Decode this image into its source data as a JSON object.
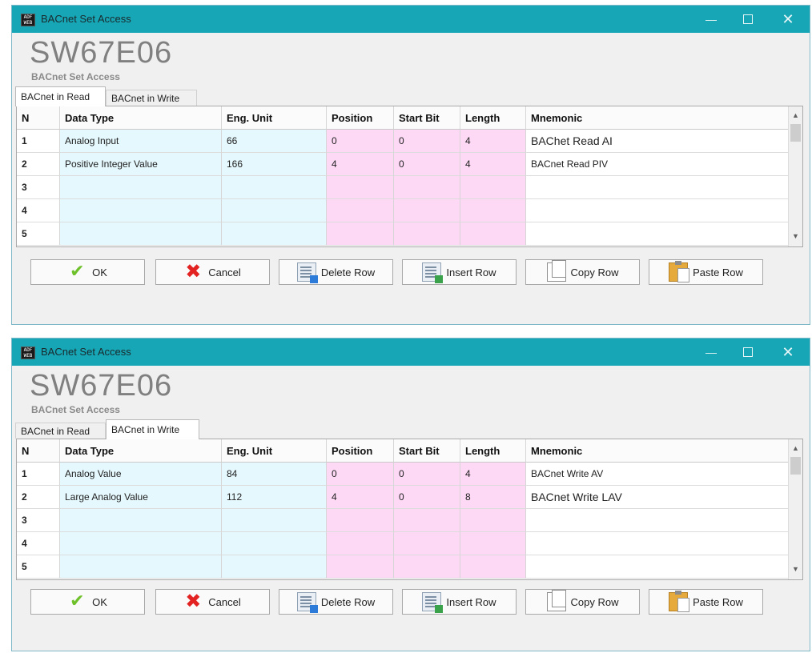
{
  "windows": [
    {
      "title": "BACnet Set Access",
      "app_icon_text": "ADF WEB",
      "product_code": "SW67E06",
      "subtitle": "BACnet Set Access",
      "active_tab": 0,
      "tabs": [
        "BACnet in Read",
        "BACnet in Write"
      ],
      "columns": [
        "N",
        "Data Type",
        "Eng. Unit",
        "Position",
        "Start Bit",
        "Length",
        "Mnemonic"
      ],
      "rows": [
        [
          "1",
          "Analog Input",
          "66",
          "0",
          "0",
          "4",
          "BAChet Read AI"
        ],
        [
          "2",
          "Positive Integer Value",
          "166",
          "4",
          "0",
          "4",
          "BACnet Read PIV"
        ],
        [
          "3",
          "",
          "",
          "",
          "",
          "",
          ""
        ],
        [
          "4",
          "",
          "",
          "",
          "",
          "",
          ""
        ],
        [
          "5",
          "",
          "",
          "",
          "",
          "",
          ""
        ]
      ],
      "buttons": {
        "ok": "OK",
        "cancel": "Cancel",
        "delete_row": "Delete Row",
        "insert_row": "Insert Row",
        "copy_row": "Copy Row",
        "paste_row": "Paste Row"
      }
    },
    {
      "title": "BACnet Set Access",
      "app_icon_text": "ADF WEB",
      "product_code": "SW67E06",
      "subtitle": "BACnet Set Access",
      "active_tab": 1,
      "tabs": [
        "BACnet in Read",
        "BACnet in Write"
      ],
      "columns": [
        "N",
        "Data Type",
        "Eng. Unit",
        "Position",
        "Start Bit",
        "Length",
        "Mnemonic"
      ],
      "rows": [
        [
          "1",
          "Analog Value",
          "84",
          "0",
          "0",
          "4",
          "BACnet Write AV"
        ],
        [
          "2",
          "Large Analog Value",
          "112",
          "4",
          "0",
          "8",
          "BACnet Write LAV"
        ],
        [
          "3",
          "",
          "",
          "",
          "",
          "",
          ""
        ],
        [
          "4",
          "",
          "",
          "",
          "",
          "",
          ""
        ],
        [
          "5",
          "",
          "",
          "",
          "",
          "",
          ""
        ]
      ],
      "buttons": {
        "ok": "OK",
        "cancel": "Cancel",
        "delete_row": "Delete Row",
        "insert_row": "Insert Row",
        "copy_row": "Copy Row",
        "paste_row": "Paste Row"
      }
    }
  ],
  "colors": {
    "titlebar": "#17a6b5",
    "blue_cells": "#e5f8fd",
    "pink_cells": "#fdd9f5"
  }
}
